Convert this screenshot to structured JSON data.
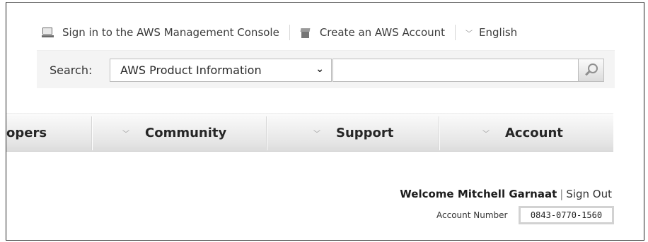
{
  "header": {
    "signin_label": "Sign in to the AWS Management Console",
    "create_label": "Create an AWS Account",
    "language_label": "English"
  },
  "search": {
    "label": "Search:",
    "scope_value": "AWS Product Information",
    "input_value": ""
  },
  "nav": {
    "items": [
      {
        "label": "opers"
      },
      {
        "label": "Community"
      },
      {
        "label": "Support"
      },
      {
        "label": "Account"
      }
    ]
  },
  "account": {
    "welcome_text": "Welcome Mitchell Garnaat",
    "separator": "|",
    "signout_label": "Sign Out",
    "number_label": "Account Number",
    "number_value": "0843-0770-1560"
  }
}
